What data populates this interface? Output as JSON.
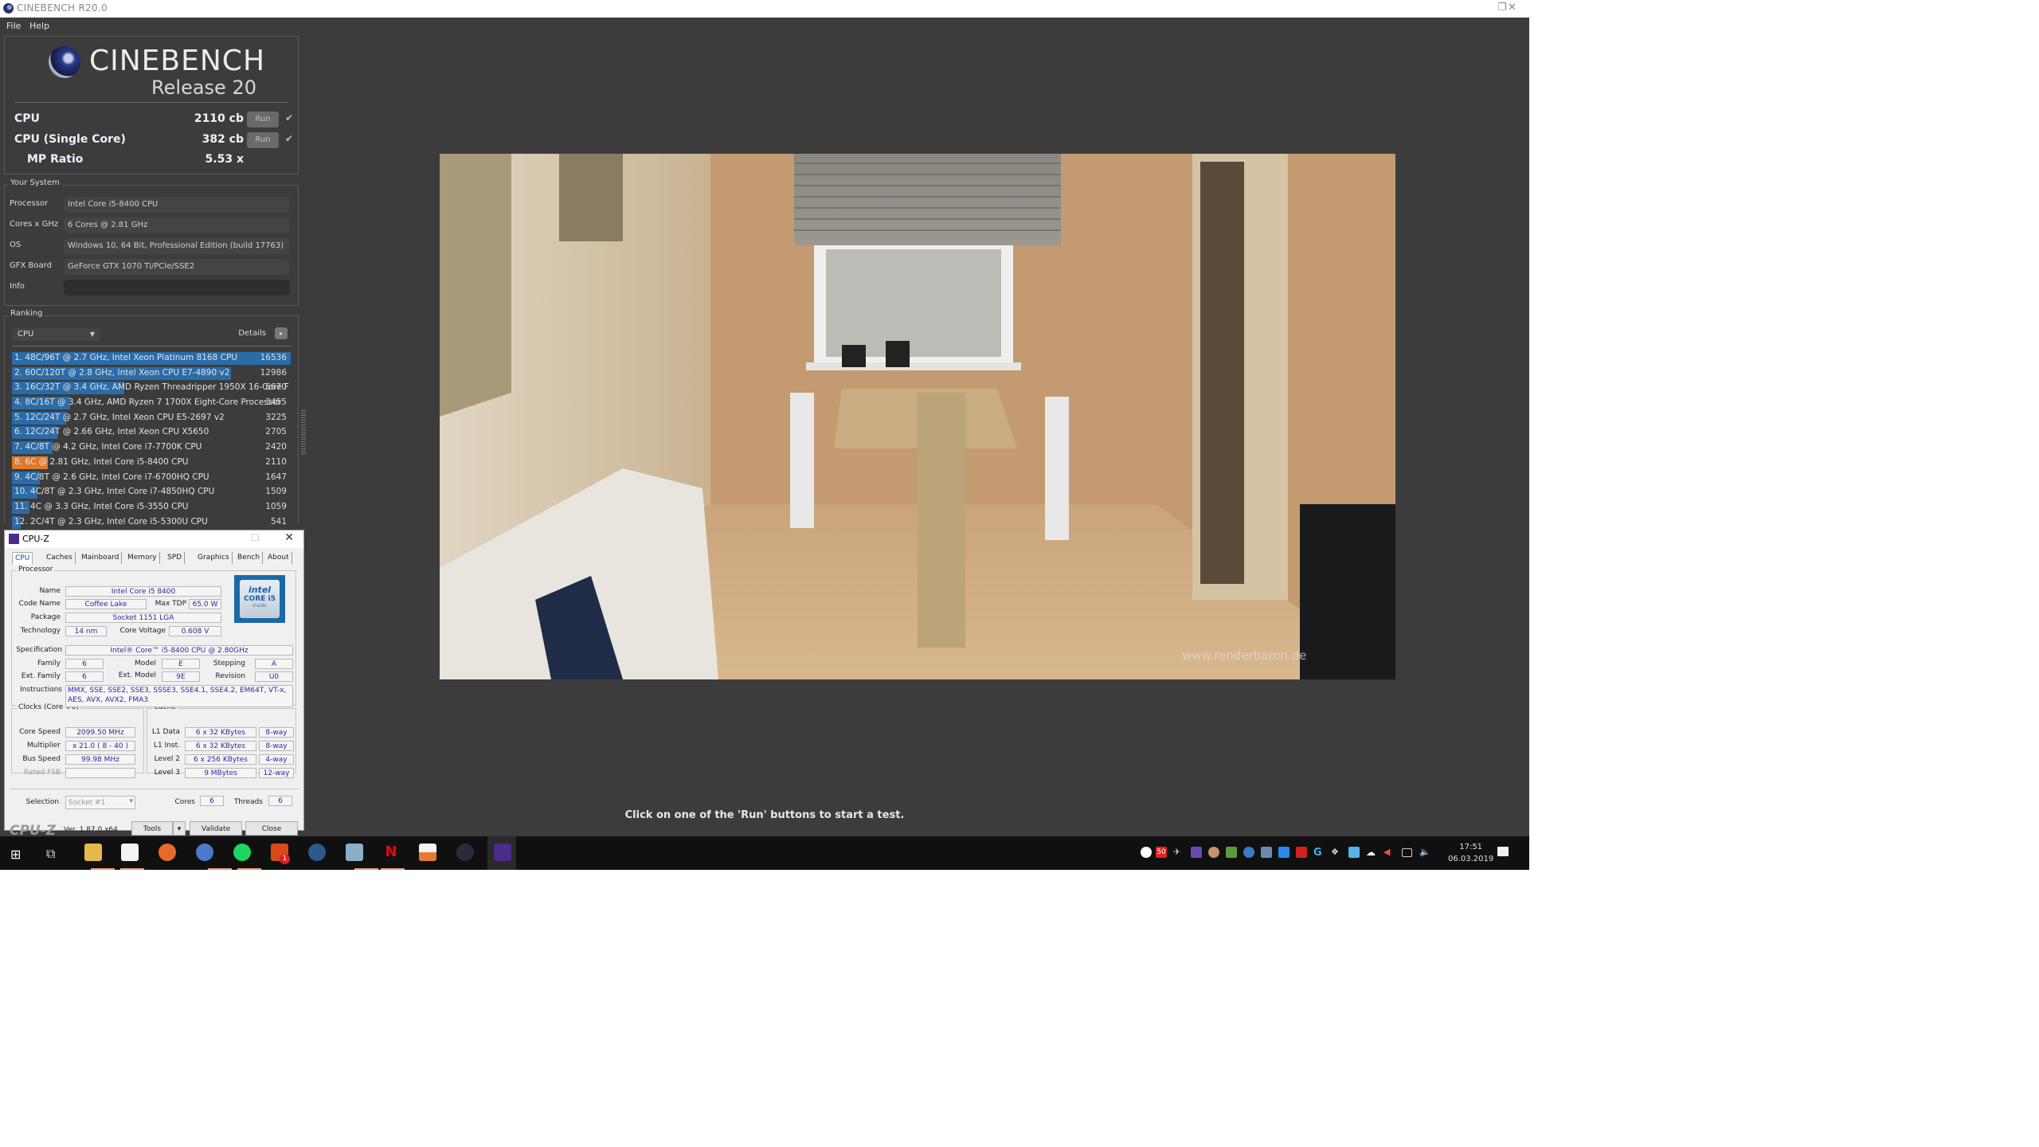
{
  "window": {
    "title": "CINEBENCH R20.0",
    "controls": {
      "restore": "❐",
      "close": "✕"
    }
  },
  "menu": [
    "File",
    "Help"
  ],
  "logo": {
    "name": "CINEBENCH",
    "release": "Release 20"
  },
  "scores": [
    {
      "label": "CPU",
      "value": "2110 cb",
      "run": "Run",
      "check": "✔"
    },
    {
      "label": "CPU (Single Core)",
      "value": "382 cb",
      "run": "Run",
      "check": "✔"
    },
    {
      "label": "MP Ratio",
      "value": "5.53 x"
    }
  ],
  "system": {
    "legend": "Your System",
    "rows": [
      {
        "key": "Processor",
        "value": "Intel Core i5-8400 CPU"
      },
      {
        "key": "Cores x GHz",
        "value": "6 Cores @ 2.81 GHz"
      },
      {
        "key": "OS",
        "value": "Windows 10, 64 Bit, Professional Edition (build 17763)"
      },
      {
        "key": "GFX Board",
        "value": "GeForce GTX 1070 Ti/PCIe/SSE2"
      },
      {
        "key": "Info",
        "value": ""
      }
    ]
  },
  "ranking": {
    "legend": "Ranking",
    "select": "CPU",
    "details_label": "Details",
    "details_icon": "▸",
    "max_score": 16536,
    "items": [
      {
        "text": "1. 48C/96T @ 2.7 GHz, Intel Xeon Platinum 8168 CPU",
        "score": 16536,
        "mine": false
      },
      {
        "text": "2. 60C/120T @ 2.8 GHz, Intel Xeon CPU E7-4890 v2",
        "score": 12986,
        "mine": false
      },
      {
        "text": "3. 16C/32T @ 3.4 GHz, AMD Ryzen Threadripper 1950X 16-Core F",
        "score": 6670,
        "mine": false
      },
      {
        "text": "4. 8C/16T @ 3.4 GHz, AMD Ryzen 7 1700X Eight-Core Processor",
        "score": 3455,
        "mine": false
      },
      {
        "text": "5. 12C/24T @ 2.7 GHz, Intel Xeon CPU E5-2697 v2",
        "score": 3225,
        "mine": false
      },
      {
        "text": "6. 12C/24T @ 2.66 GHz, Intel Xeon CPU X5650",
        "score": 2705,
        "mine": false
      },
      {
        "text": "7. 4C/8T @ 4.2 GHz, Intel Core i7-7700K CPU",
        "score": 2420,
        "mine": false
      },
      {
        "text": "8. 6C @ 2.81 GHz, Intel Core i5-8400 CPU",
        "score": 2110,
        "mine": true
      },
      {
        "text": "9. 4C/8T @ 2.6 GHz, Intel Core i7-6700HQ CPU",
        "score": 1647,
        "mine": false
      },
      {
        "text": "10. 4C/8T @ 2.3 GHz, Intel Core i7-4850HQ CPU",
        "score": 1509,
        "mine": false
      },
      {
        "text": "11. 4C @ 3.3 GHz, Intel Core i5-3550 CPU",
        "score": 1059,
        "mine": false
      },
      {
        "text": "12. 2C/4T @ 2.3 GHz, Intel Core i5-5300U CPU",
        "score": 541,
        "mine": false
      }
    ]
  },
  "render": {
    "watermark": "www.renderbaron.de"
  },
  "status": "Click on one of the 'Run' buttons to start a test.",
  "cpuz": {
    "title": "CPU-Z",
    "tabs": [
      "CPU",
      "Caches",
      "Mainboard",
      "Memory",
      "SPD",
      "Graphics",
      "Bench",
      "About"
    ],
    "active_tab": "CPU",
    "processor_legend": "Processor",
    "name_label": "Name",
    "name": "Intel Core i5 8400",
    "codename_label": "Code Name",
    "codename": "Coffee Lake",
    "tdp_label": "Max TDP",
    "tdp": "65.0 W",
    "package_label": "Package",
    "package": "Socket 1151 LGA",
    "tech_label": "Technology",
    "tech": "14 nm",
    "voltage_label": "Core Voltage",
    "voltage": "0.608 V",
    "spec_label": "Specification",
    "spec": "Intel® Core™ i5-8400 CPU @ 2.80GHz",
    "family_label": "Family",
    "family": "6",
    "model_label": "Model",
    "model": "E",
    "stepping_label": "Stepping",
    "stepping": "A",
    "extfamily_label": "Ext. Family",
    "extfamily": "6",
    "extmodel_label": "Ext. Model",
    "extmodel": "9E",
    "revision_label": "Revision",
    "revision": "U0",
    "instructions_label": "Instructions",
    "instructions": "MMX, SSE, SSE2, SSE3, SSSE3, SSE4.1, SSE4.2, EM64T, VT-x, AES, AVX, AVX2, FMA3",
    "intel_logo": {
      "brand": "intel",
      "line": "CORE i5",
      "tag": "inside"
    },
    "clocks_legend": "Clocks (Core #0)",
    "corespeed_label": "Core Speed",
    "corespeed": "2099.50 MHz",
    "multiplier_label": "Multiplier",
    "multiplier": "x 21.0 ( 8 - 40 )",
    "busspeed_label": "Bus Speed",
    "busspeed": "99.98 MHz",
    "ratedfsb_label": "Rated FSB",
    "ratedfsb": "",
    "cache_legend": "Cache",
    "cache": [
      {
        "label": "L1 Data",
        "size": "6 x 32 KBytes",
        "way": "8-way"
      },
      {
        "label": "L1 Inst.",
        "size": "6 x 32 KBytes",
        "way": "8-way"
      },
      {
        "label": "Level 2",
        "size": "6 x 256 KBytes",
        "way": "4-way"
      },
      {
        "label": "Level 3",
        "size": "9 MBytes",
        "way": "12-way"
      }
    ],
    "selection_label": "Selection",
    "selection": "Socket #1",
    "cores_label": "Cores",
    "cores": "6",
    "threads_label": "Threads",
    "threads": "6",
    "brand": "CPU-Z",
    "version": "Ver. 1.87.0.x64",
    "tools": "Tools",
    "validate": "Validate",
    "close": "Close"
  },
  "taskbar": {
    "apps": [
      "start",
      "task-view",
      "file-explorer",
      "microsoft-store",
      "firefox",
      "thunderbird",
      "spotify",
      "notification-app",
      "teamspeak",
      "notepad",
      "netflix",
      "sky-go",
      "cinebench",
      "cpu-z"
    ],
    "notification_badge": "1",
    "tray_badge": "50",
    "time": "17:51",
    "date": "06.03.2019"
  }
}
